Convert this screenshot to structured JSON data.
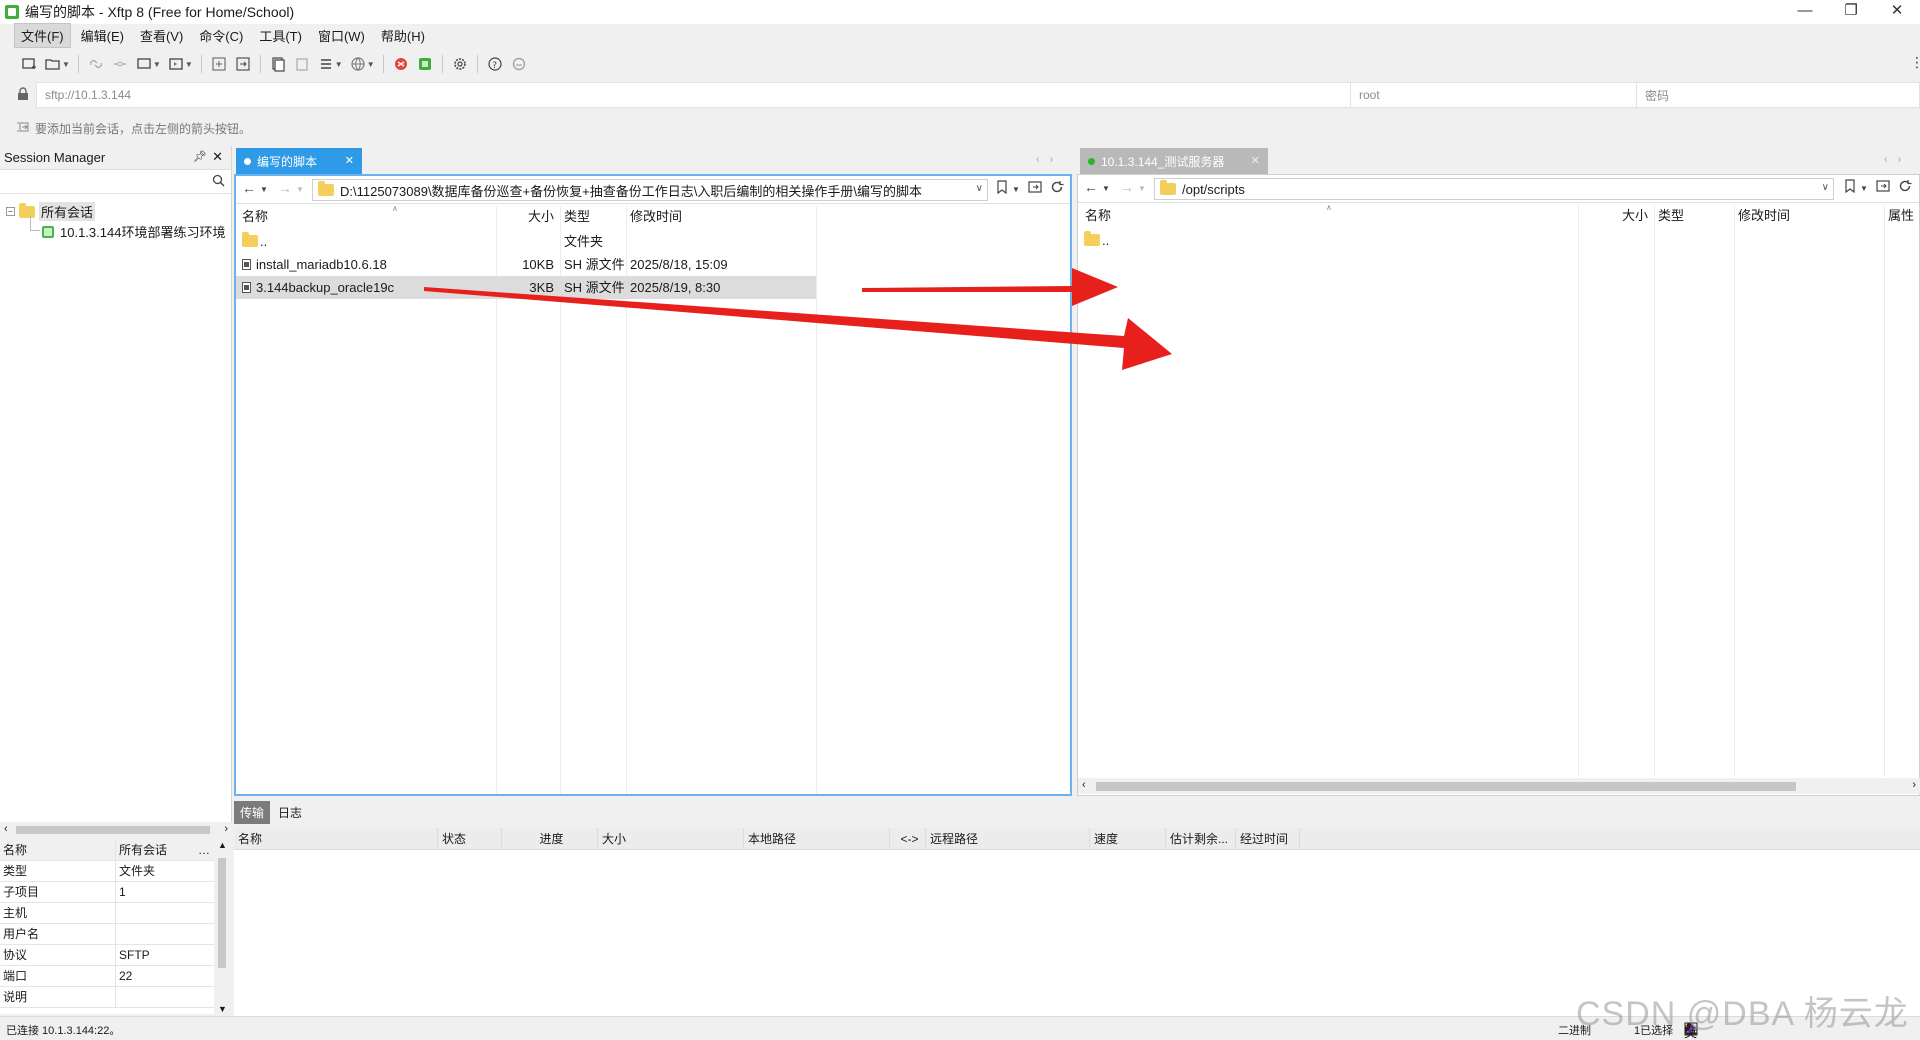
{
  "window": {
    "title": "编写的脚本 - Xftp 8 (Free for Home/School)",
    "min": "—",
    "max": "❐",
    "close": "✕"
  },
  "menu": [
    "文件(F)",
    "编辑(E)",
    "查看(V)",
    "命令(C)",
    "工具(T)",
    "窗口(W)",
    "帮助(H)"
  ],
  "address": {
    "url": "sftp://10.1.3.144",
    "username": "root",
    "password_placeholder": "密码"
  },
  "hint": "要添加当前会话，点击左侧的箭头按钮。",
  "session_manager": {
    "title": "Session Manager",
    "root": "所有会话",
    "items": [
      "10.1.3.144环境部署练习环境"
    ]
  },
  "properties": {
    "header": {
      "key": "名称",
      "value": "所有会话"
    },
    "rows": [
      {
        "key": "类型",
        "value": "文件夹"
      },
      {
        "key": "子项目",
        "value": "1"
      },
      {
        "key": "主机",
        "value": ""
      },
      {
        "key": "用户名",
        "value": ""
      },
      {
        "key": "协议",
        "value": "SFTP"
      },
      {
        "key": "端口",
        "value": "22"
      },
      {
        "key": "说明",
        "value": ""
      }
    ]
  },
  "local_pane": {
    "tab": "编写的脚本",
    "path": "D:\\1125073089\\数据库备份巡查+备份恢复+抽查备份工作日志\\入职后编制的相关操作手册\\编写的脚本",
    "columns": [
      "名称",
      "大小",
      "类型",
      "修改时间"
    ],
    "files": [
      {
        "name": "..",
        "size": "",
        "type": "文件夹",
        "modified": ""
      },
      {
        "name": "install_mariadb10.6.18",
        "size": "10KB",
        "type": "SH 源文件",
        "modified": "2025/8/18, 15:09"
      },
      {
        "name": "3.144backup_oracle19c",
        "size": "3KB",
        "type": "SH 源文件",
        "modified": "2025/8/19, 8:30"
      }
    ]
  },
  "remote_pane": {
    "tab": "10.1.3.144_测试服务器",
    "path": "/opt/scripts",
    "columns": [
      "名称",
      "大小",
      "类型",
      "修改时间",
      "属性"
    ],
    "files": [
      {
        "name": ".."
      }
    ]
  },
  "transfer": {
    "tabs": [
      "传输",
      "日志"
    ],
    "columns": [
      "名称",
      "状态",
      "进度",
      "大小",
      "本地路径",
      "<->",
      "远程路径",
      "速度",
      "估计剩余...",
      "经过时间"
    ]
  },
  "status": {
    "left": "已连接 10.1.3.144:22。",
    "mode": "二进制",
    "selected": "1已选择",
    "ime": "英"
  },
  "watermark": "CSDN @DBA 杨云龙",
  "colors": {
    "local_tab": "#2f9be8",
    "annotation_arrow": "#e8201c",
    "remote_dot": "#27b427"
  }
}
